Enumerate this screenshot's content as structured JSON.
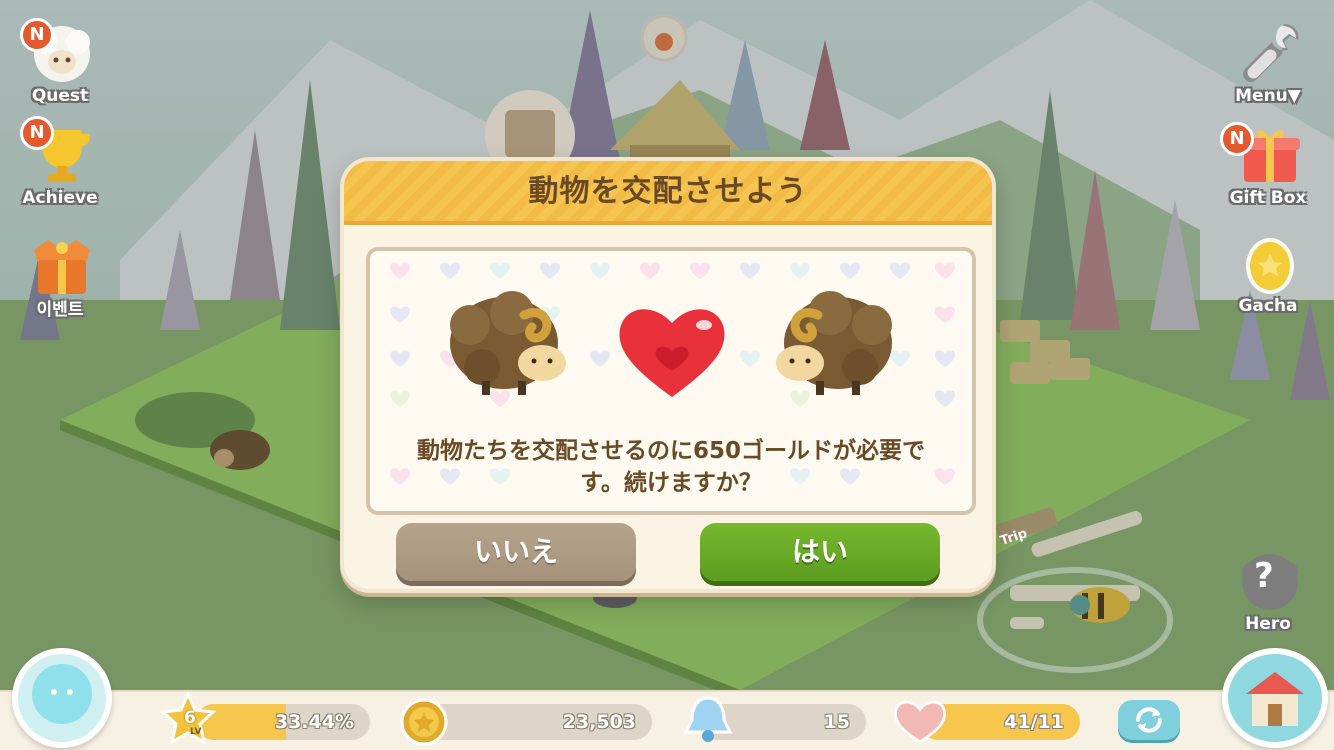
{
  "dialog": {
    "title": "動物を交配させよう",
    "message_line1": "動物たちを交配させるのに650ゴールドが必要で",
    "message_line2": "す。続けますか？",
    "no_label": "いいえ",
    "yes_label": "はい"
  },
  "left_menu": {
    "quest_label": "Quest",
    "achieve_label": "Achieve",
    "event_label": "이벤트",
    "new_badge": "N"
  },
  "right_menu": {
    "menu_label": "Menu▼",
    "giftbox_label": "Gift Box",
    "gacha_label": "Gacha",
    "hero_label": "Hero",
    "hero_symbol": "?"
  },
  "trip_sign": "Trip",
  "status_bar": {
    "level": "6",
    "level_tag": "LV",
    "exp_percent": "33.44%",
    "exp_fill_fraction": 0.3344,
    "gold": "23,503",
    "bells": "15",
    "hearts": "41/11",
    "hearts_fill_fraction": 1.0
  },
  "colors": {
    "header_yellow": "#f6c451",
    "yes_green": "#6aab27",
    "no_taupe": "#ad9a82",
    "title_brown": "#6a4a25"
  }
}
